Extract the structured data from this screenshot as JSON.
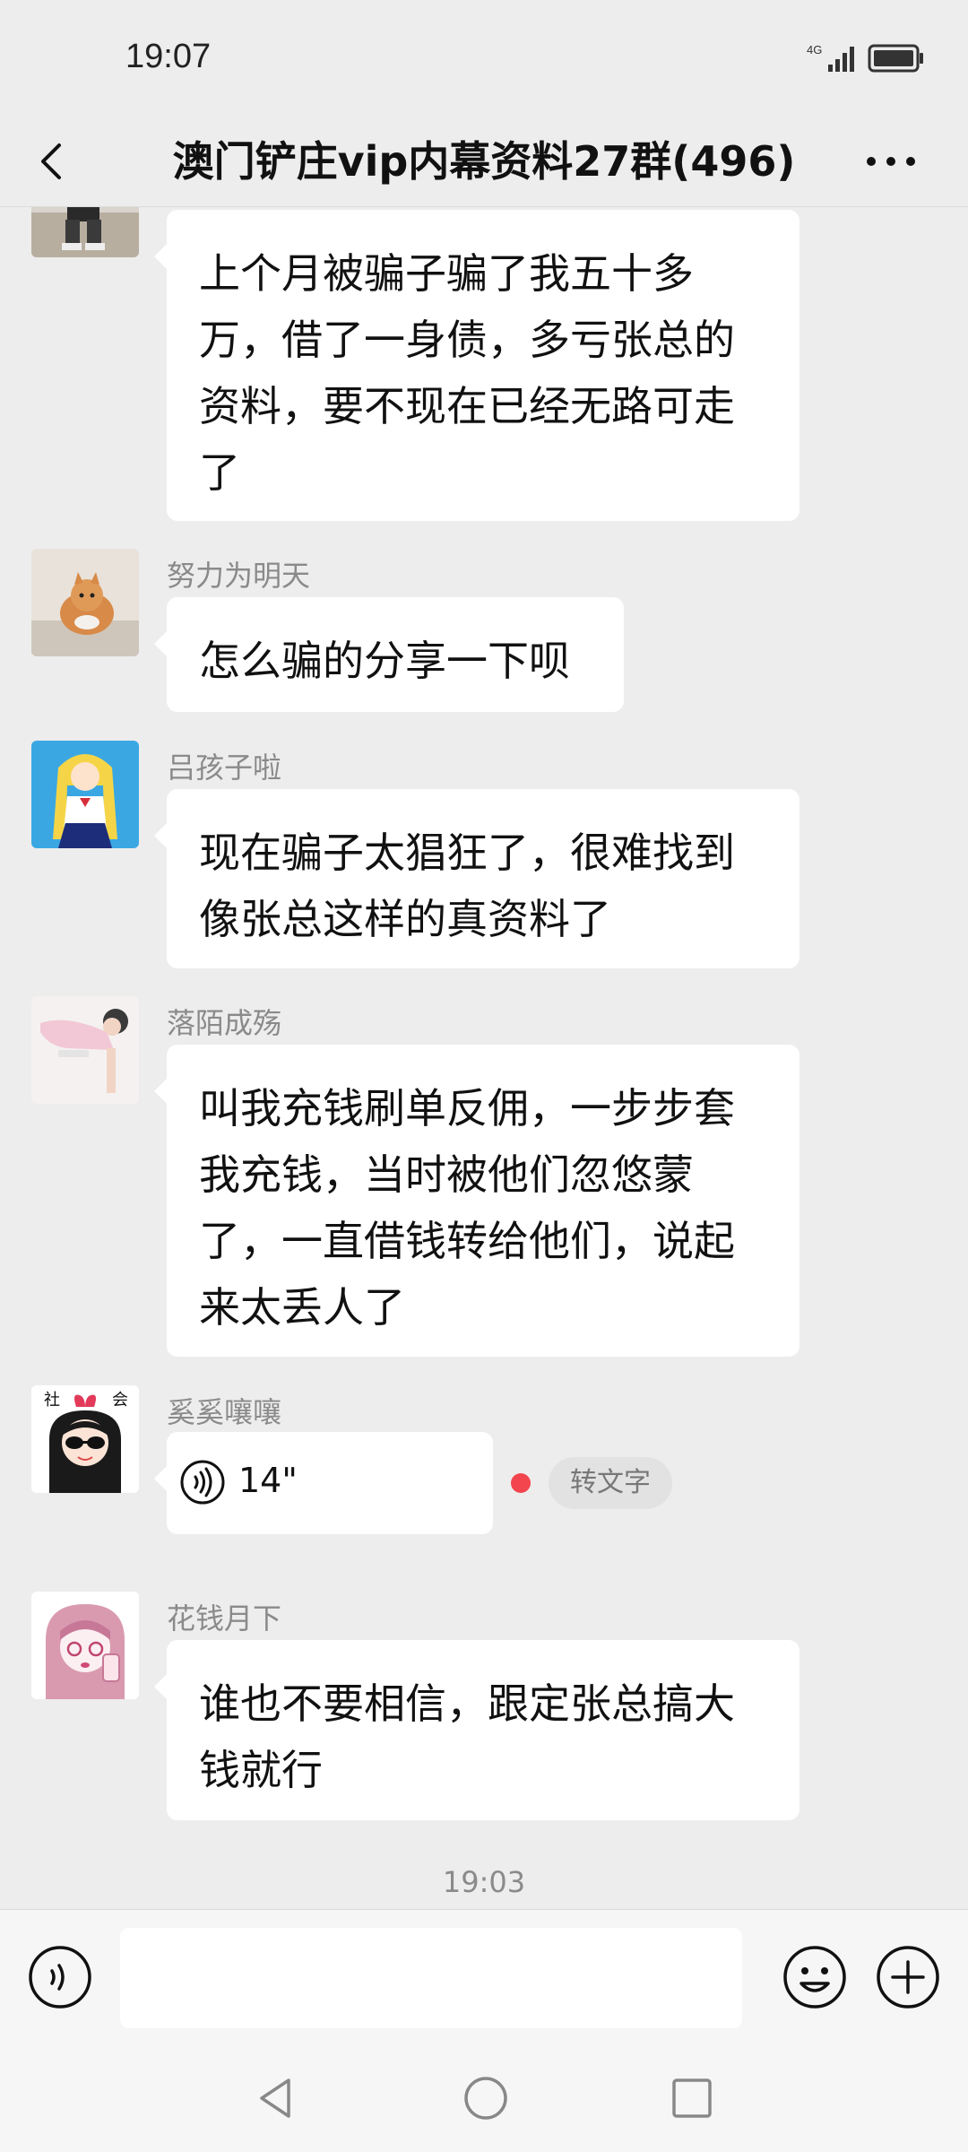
{
  "status_bar": {
    "time": "19:07",
    "network": "4G"
  },
  "header": {
    "title": "澳门铲庄vip内幕资料27群(496)"
  },
  "messages": [
    {
      "sender": "",
      "text": "上个月被骗子骗了我五十多万，借了一身债，多亏张总的资料，要不现在已经无路可走了"
    },
    {
      "sender": "努力为明天",
      "text": "怎么骗的分享一下呗"
    },
    {
      "sender": "吕孩子啦",
      "text": "现在骗子太猖狂了，很难找到像张总这样的真资料了"
    },
    {
      "sender": "落陌成殇",
      "text": "叫我充钱刷单反佣，一步步套我充钱，当时被他们忽悠蒙了，一直借钱转给他们，说起来太丢人了"
    },
    {
      "sender": "奚奚嚷嚷",
      "voice_duration": "14\"",
      "to_text_label": "转文字",
      "avatar_text": "社会"
    },
    {
      "sender": "花钱月下",
      "text": "谁也不要相信，跟定张总搞大钱就行"
    }
  ],
  "timestamp": "19:03",
  "colors": {
    "background": "#ededed",
    "bubble": "#ffffff",
    "unread_dot": "#f2454d",
    "sender_name": "#8a8a8a"
  }
}
